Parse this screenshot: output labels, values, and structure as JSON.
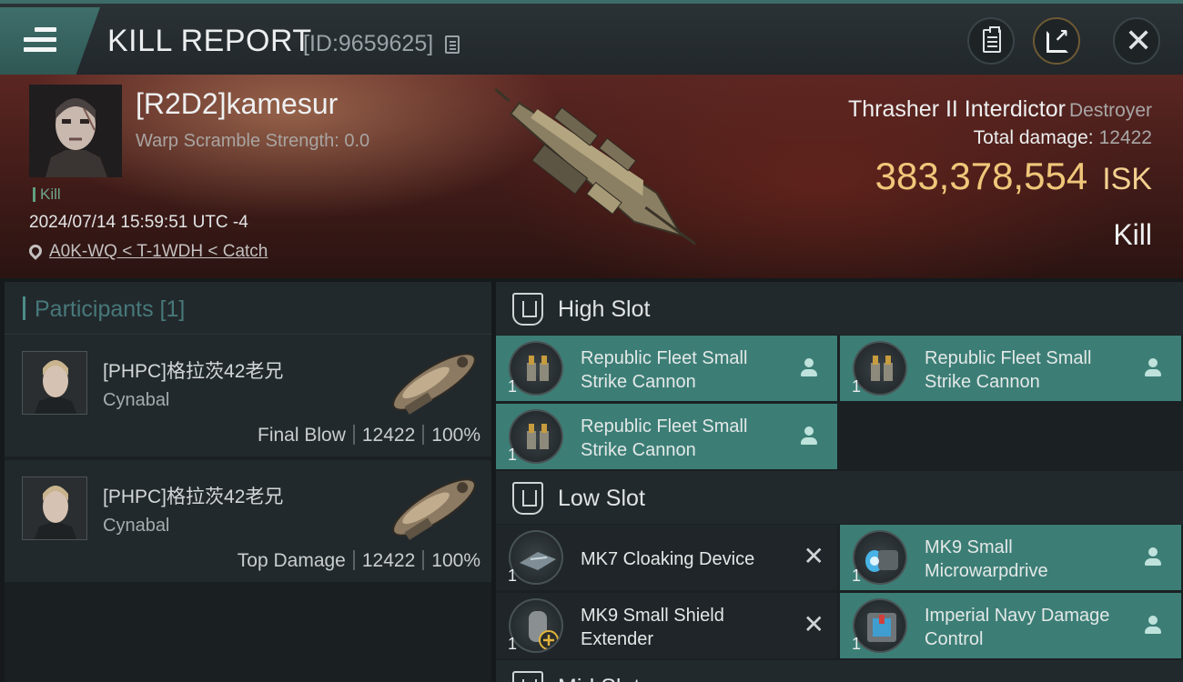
{
  "header": {
    "title": "KILL REPORT",
    "report_id": "[ID:9659625]",
    "icons": {
      "menu": "hamburger-menu-icon",
      "copy": "copy-icon",
      "clipboard": "clipboard-icon",
      "share": "share-icon",
      "close": "close-icon"
    }
  },
  "victim": {
    "name": "[R2D2]kamesur",
    "warp_scramble": "Warp Scramble Strength: 0.0",
    "tag": "Kill",
    "timestamp": "2024/07/14 15:59:51 UTC -4",
    "location": "A0K-WQ < T-1WDH < Catch",
    "ship_name": "Thrasher II Interdictor",
    "ship_class": "Destroyer",
    "total_damage_label": "Total damage:",
    "total_damage": "12422",
    "isk_value": "383,378,554",
    "isk_unit": "ISK",
    "result": "Kill"
  },
  "participants": {
    "title": "Participants [1]",
    "rows": [
      {
        "name": "[PHPC]格拉茨42老兄",
        "corp": "Cynabal",
        "role": "Final Blow",
        "damage": "12422",
        "percent": "100%"
      },
      {
        "name": "[PHPC]格拉茨42老兄",
        "corp": "Cynabal",
        "role": "Top Damage",
        "damage": "12422",
        "percent": "100%"
      }
    ]
  },
  "slots": {
    "high": {
      "title": "High Slot",
      "modules": [
        {
          "name": "Republic Fleet Small Strike Cannon",
          "qty": "1",
          "status": "dropped"
        },
        {
          "name": "Republic Fleet Small Strike Cannon",
          "qty": "1",
          "status": "dropped"
        },
        {
          "name": "Republic Fleet Small Strike Cannon",
          "qty": "1",
          "status": "dropped"
        }
      ]
    },
    "low": {
      "title": "Low Slot",
      "modules": [
        {
          "name": "MK7 Cloaking Device",
          "qty": "1",
          "status": "destroyed"
        },
        {
          "name": "MK9 Small Microwarpdrive",
          "qty": "1",
          "status": "dropped"
        },
        {
          "name": "MK9 Small Shield Extender",
          "qty": "1",
          "status": "destroyed"
        },
        {
          "name": "Imperial Navy Damage Control",
          "qty": "1",
          "status": "dropped"
        }
      ]
    },
    "mid": {
      "title": "Mid Slot"
    }
  },
  "colors": {
    "accent": "#3c7e76",
    "isk": "#f0c77a",
    "banner": "#5b2622"
  }
}
